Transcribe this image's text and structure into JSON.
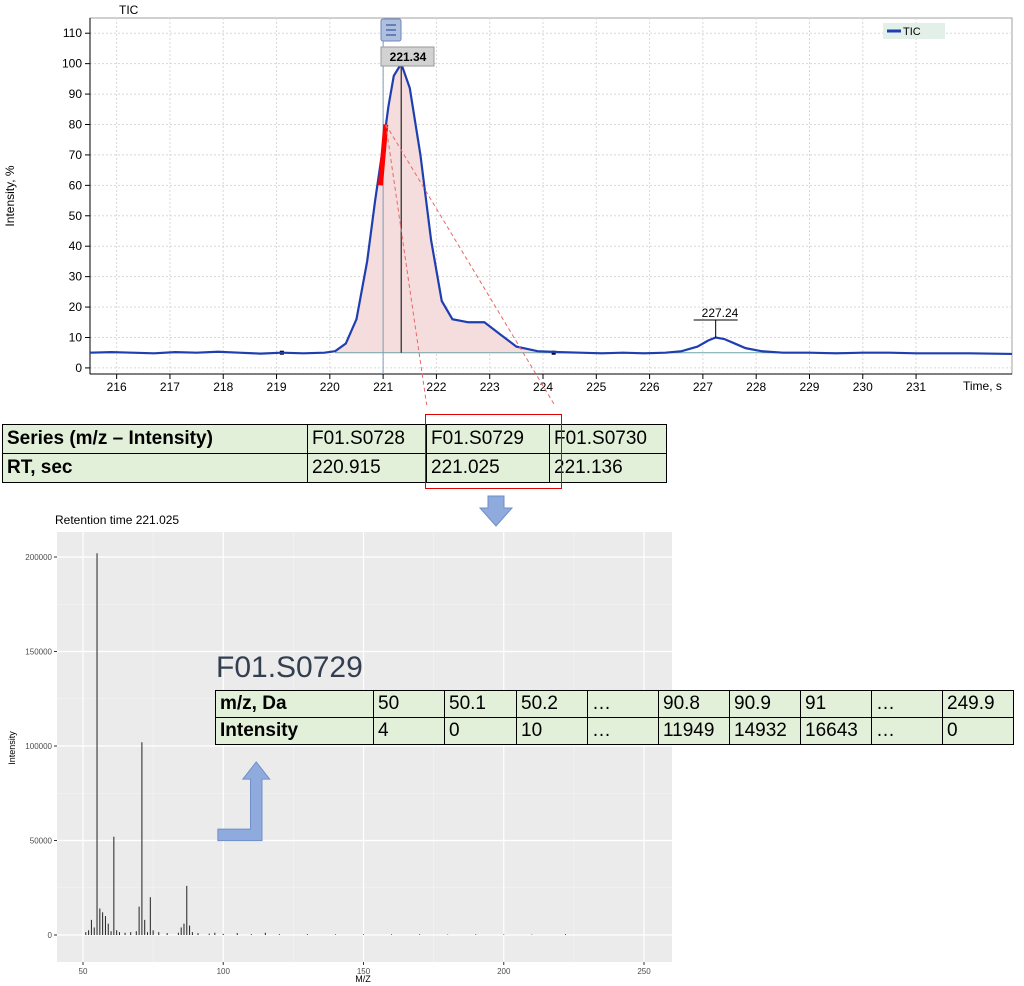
{
  "tic_chart": {
    "title": "TIC",
    "ylabel": "Intensity, %",
    "xlabel": "Time, s",
    "legend": "TIC",
    "peak_label": "221.34",
    "peak2_label": "227.24",
    "line_color": "#1f3fb0",
    "fill_color": "#f5dddd",
    "highlight_color": "#ff0000"
  },
  "series_table": {
    "rows": [
      [
        "Series (m/z – Intensity)",
        "F01.S0728",
        "F01.S0729",
        "F01.S0730"
      ],
      [
        "RT, sec",
        "220.915",
        "221.025",
        "221.136"
      ]
    ]
  },
  "spectrum_chart": {
    "title": "Retention time 221.025",
    "xlabel": "M/Z",
    "ylabel": "Intensity",
    "panel_color": "#ebebeb"
  },
  "spectrum_label": "F01.S0729",
  "spectrum_table": {
    "rows": [
      [
        "m/z, Da",
        "50",
        "50.1",
        "50.2",
        "…",
        "90.8",
        "90.9",
        "91",
        "…",
        "249.9"
      ],
      [
        "Intensity",
        "4",
        "0",
        "10",
        "…",
        "11949",
        "14932",
        "16643",
        "…",
        "0"
      ]
    ]
  },
  "chart_data": [
    {
      "type": "line",
      "title": "TIC",
      "xlabel": "Time, s",
      "ylabel": "Intensity, %",
      "xlim": [
        215.5,
        232.8
      ],
      "ylim": [
        -2,
        115
      ],
      "xticks": [
        216,
        217,
        218,
        219,
        220,
        221,
        222,
        223,
        224,
        225,
        226,
        227,
        228,
        229,
        230,
        231
      ],
      "yticks": [
        0,
        10,
        20,
        30,
        40,
        50,
        60,
        70,
        80,
        90,
        100,
        110
      ],
      "grid": true,
      "legend": "top-right",
      "series": [
        {
          "name": "TIC",
          "x": [
            215.5,
            215.9,
            216.3,
            216.7,
            217.1,
            217.5,
            217.9,
            218.3,
            218.7,
            219.1,
            219.5,
            219.9,
            220.1,
            220.3,
            220.5,
            220.7,
            220.85,
            221.0,
            221.1,
            221.2,
            221.34,
            221.5,
            221.7,
            221.9,
            222.1,
            222.3,
            222.6,
            222.9,
            223.2,
            223.5,
            223.9,
            224.3,
            224.7,
            225.1,
            225.5,
            225.9,
            226.3,
            226.6,
            226.9,
            227.1,
            227.24,
            227.4,
            227.6,
            227.8,
            228.1,
            228.5,
            229.0,
            229.5,
            230.0,
            230.5,
            231.0,
            231.5,
            232.0,
            232.8
          ],
          "y": [
            5,
            5.2,
            5,
            4.8,
            5.2,
            5,
            5.3,
            5,
            4.7,
            5,
            4.8,
            5,
            5.5,
            8,
            16,
            35,
            55,
            73,
            86,
            96,
            100,
            92,
            70,
            42,
            22,
            16,
            15,
            15,
            11,
            7,
            5.5,
            5.2,
            5,
            4.8,
            5,
            4.8,
            5,
            5.5,
            7,
            9,
            10,
            9.5,
            8,
            6.5,
            5.5,
            5,
            5,
            4.8,
            5,
            5,
            4.8,
            4.8,
            4.8,
            4.6
          ]
        }
      ],
      "annotations": [
        {
          "x": 221.34,
          "label": "221.34"
        },
        {
          "x": 227.24,
          "label": "227.24"
        }
      ],
      "baseline": 5,
      "highlight_range": [
        220.915,
        221.136
      ]
    },
    {
      "type": "bar",
      "title": "Retention time 221.025",
      "xlabel": "M/Z",
      "ylabel": "Intensity",
      "xlim": [
        50,
        252
      ],
      "ylim": [
        0,
        210000
      ],
      "xticks": [
        50,
        100,
        150,
        200,
        250
      ],
      "yticks": [
        0,
        50000,
        100000,
        150000,
        200000
      ],
      "grid": true,
      "x": [
        51,
        52,
        53,
        54,
        55,
        56,
        57,
        58,
        59,
        60,
        61,
        62,
        63,
        65,
        67,
        69,
        70,
        71,
        72,
        73,
        74,
        75,
        77,
        80,
        84,
        85,
        86,
        87,
        88,
        89,
        91,
        95,
        97,
        100,
        105,
        110,
        115,
        120,
        130,
        140,
        150,
        160,
        170,
        180,
        190,
        200,
        210,
        222
      ],
      "values": [
        1500,
        2500,
        8000,
        4000,
        202000,
        14000,
        12000,
        10000,
        6000,
        2000,
        52000,
        2500,
        1500,
        1200,
        1500,
        2000,
        15000,
        102000,
        8000,
        1500,
        20000,
        2500,
        1500,
        1000,
        1200,
        4000,
        6000,
        26000,
        5000,
        1500,
        1000,
        700,
        1200,
        600,
        1000,
        400,
        1200,
        400,
        400,
        300,
        300,
        300,
        300,
        200,
        300,
        300,
        200,
        400
      ]
    }
  ]
}
